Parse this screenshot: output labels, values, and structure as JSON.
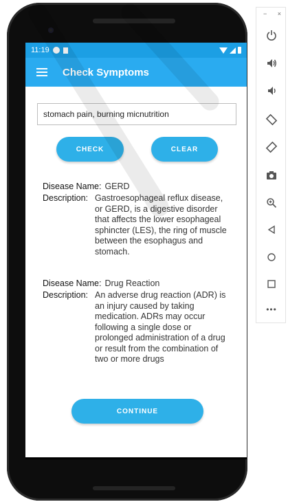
{
  "status_bar": {
    "time": "11:19"
  },
  "app_bar": {
    "title": "Check Symptoms"
  },
  "search": {
    "value": "stomach pain, burning micnutrition"
  },
  "buttons": {
    "check": "CHECK",
    "clear": "CLEAR",
    "continue": "CONTINUE"
  },
  "results": [
    {
      "name_label": "Disease Name:",
      "name": "GERD",
      "description_label": "Description:",
      "description": "Gastroesophageal reflux disease, or GERD, is a digestive disorder that affects the lower esophageal sphincter (LES), the ring of muscle between the esophagus and stomach."
    },
    {
      "name_label": "Disease Name:",
      "name": "Drug Reaction",
      "description_label": "Description:",
      "description": "An adverse drug reaction (ADR) is an injury caused by taking medication. ADRs may occur following a single dose or prolonged administration of a drug or result from the combination of two or more drugs"
    }
  ],
  "nav_bar": {
    "back": "◀",
    "home": "●",
    "recents": "■"
  },
  "emulator_toolbar": {
    "minimize": "−",
    "close": "×",
    "icons": [
      "power-icon",
      "volume-up-icon",
      "volume-down-icon",
      "rotate-left-icon",
      "rotate-right-icon",
      "camera-icon",
      "zoom-icon",
      "back-icon",
      "home-icon",
      "overview-icon",
      "more-icon"
    ]
  },
  "colors": {
    "status_bar": "#1c9fe4",
    "app_bar": "#2aabf0",
    "button": "#2eb0e8"
  }
}
